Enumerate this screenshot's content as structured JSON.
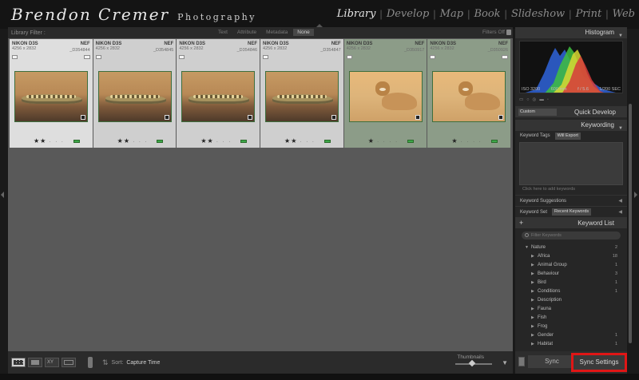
{
  "app": {
    "brand_signature": "Brendon Cremer",
    "brand_subtitle": "Photography"
  },
  "modules": [
    {
      "label": "Library",
      "active": true
    },
    {
      "label": "Develop",
      "active": false
    },
    {
      "label": "Map",
      "active": false
    },
    {
      "label": "Book",
      "active": false
    },
    {
      "label": "Slideshow",
      "active": false
    },
    {
      "label": "Print",
      "active": false
    },
    {
      "label": "Web",
      "active": false
    }
  ],
  "filter_bar": {
    "label": "Library Filter :",
    "tabs": [
      "Text",
      "Attribute",
      "Metadata",
      "None"
    ],
    "active_tab": "None",
    "status": "Filters Off"
  },
  "thumbnails": [
    {
      "camera": "NIKON D3S",
      "ext": "NEF",
      "dims": "4256 x 2832",
      "file": "_D354844",
      "stars": "★★",
      "subject": "crocodile"
    },
    {
      "camera": "NIKON D3S",
      "ext": "NEF",
      "dims": "4256 x 2832",
      "file": "_D354845",
      "stars": "★★",
      "subject": "crocodile"
    },
    {
      "camera": "NIKON D3S",
      "ext": "NEF",
      "dims": "4256 x 2832",
      "file": "_D354846",
      "stars": "★★",
      "subject": "crocodile"
    },
    {
      "camera": "NIKON D3S",
      "ext": "NEF",
      "dims": "4256 x 2832",
      "file": "_D354847",
      "stars": "★★",
      "subject": "crocodile"
    },
    {
      "camera": "NIKON D3S",
      "ext": "NEF",
      "dims": "4256 x 2832",
      "file": "_D350917",
      "stars": "★",
      "subject": "lion"
    },
    {
      "camera": "NIKON D3S",
      "ext": "NEF",
      "dims": "4256 x 2832",
      "file": "_D350926",
      "stars": "★",
      "subject": "lion"
    }
  ],
  "toolbar": {
    "sort_label": "Sort:",
    "sort_value": "Capture Time",
    "thumbnails_label": "Thumbnails",
    "thumbnail_size": 0.45
  },
  "right_panel": {
    "histogram": {
      "title": "Histogram",
      "iso": "ISO 3200",
      "focal": "600 mm",
      "aperture": "f / 5.6",
      "shutter": "1/200 SEC"
    },
    "quick_develop": {
      "title": "Quick Develop",
      "preset": "Custom"
    },
    "keywording": {
      "title": "Keywording",
      "tags_label": "Keyword Tags",
      "tags_value": "Will Export",
      "add_hint": "Click here to add keywords",
      "suggestions_label": "Keyword Suggestions",
      "set_label": "Keyword Set",
      "set_value": "Recent Keywords"
    },
    "keyword_list": {
      "title": "Keyword List",
      "search_placeholder": "Filter Keywords",
      "root": {
        "label": "Nature",
        "count": "2"
      },
      "items": [
        {
          "label": "Africa",
          "count": "18"
        },
        {
          "label": "Animal Group",
          "count": "1"
        },
        {
          "label": "Behaviour",
          "count": "3"
        },
        {
          "label": "Bird",
          "count": "1"
        },
        {
          "label": "Conditions",
          "count": "1"
        },
        {
          "label": "Description",
          "count": ""
        },
        {
          "label": "Fauna",
          "count": ""
        },
        {
          "label": "Fish",
          "count": ""
        },
        {
          "label": "Frog",
          "count": ""
        },
        {
          "label": "Gender",
          "count": "1"
        },
        {
          "label": "Habitat",
          "count": "1"
        }
      ]
    },
    "sync_label": "Sync",
    "sync_settings_label": "Sync Settings"
  },
  "colors": {
    "highlight": "#e01616",
    "selected_cell": "#8c9c88",
    "label_green": "#3ea84a"
  }
}
